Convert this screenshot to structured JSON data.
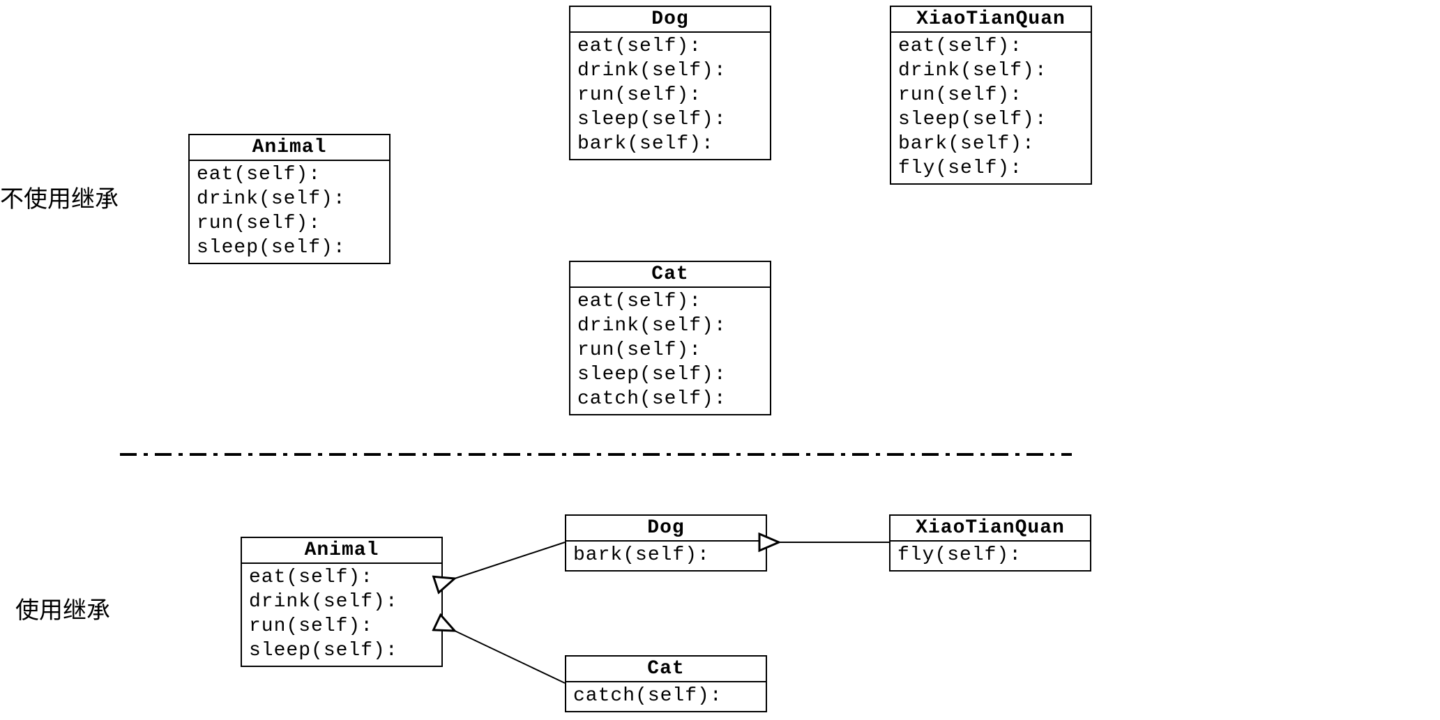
{
  "section1": {
    "label": "不使用继承",
    "animal": {
      "name": "Animal",
      "methods": [
        "eat(self):",
        "drink(self):",
        "run(self):",
        "sleep(self):"
      ]
    },
    "dog": {
      "name": "Dog",
      "methods": [
        "eat(self):",
        "drink(self):",
        "run(self):",
        "sleep(self):",
        "bark(self):"
      ]
    },
    "cat": {
      "name": "Cat",
      "methods": [
        "eat(self):",
        "drink(self):",
        "run(self):",
        "sleep(self):",
        "catch(self):"
      ]
    },
    "xtq": {
      "name": "XiaoTianQuan",
      "methods": [
        "eat(self):",
        "drink(self):",
        "run(self):",
        "sleep(self):",
        "bark(self):",
        "fly(self):"
      ]
    }
  },
  "section2": {
    "label": "使用继承",
    "animal": {
      "name": "Animal",
      "methods": [
        "eat(self):",
        "drink(self):",
        "run(self):",
        "sleep(self):"
      ]
    },
    "dog": {
      "name": "Dog",
      "methods": [
        "bark(self):"
      ]
    },
    "cat": {
      "name": "Cat",
      "methods": [
        "catch(self):"
      ]
    },
    "xtq": {
      "name": "XiaoTianQuan",
      "methods": [
        "fly(self):"
      ]
    }
  }
}
